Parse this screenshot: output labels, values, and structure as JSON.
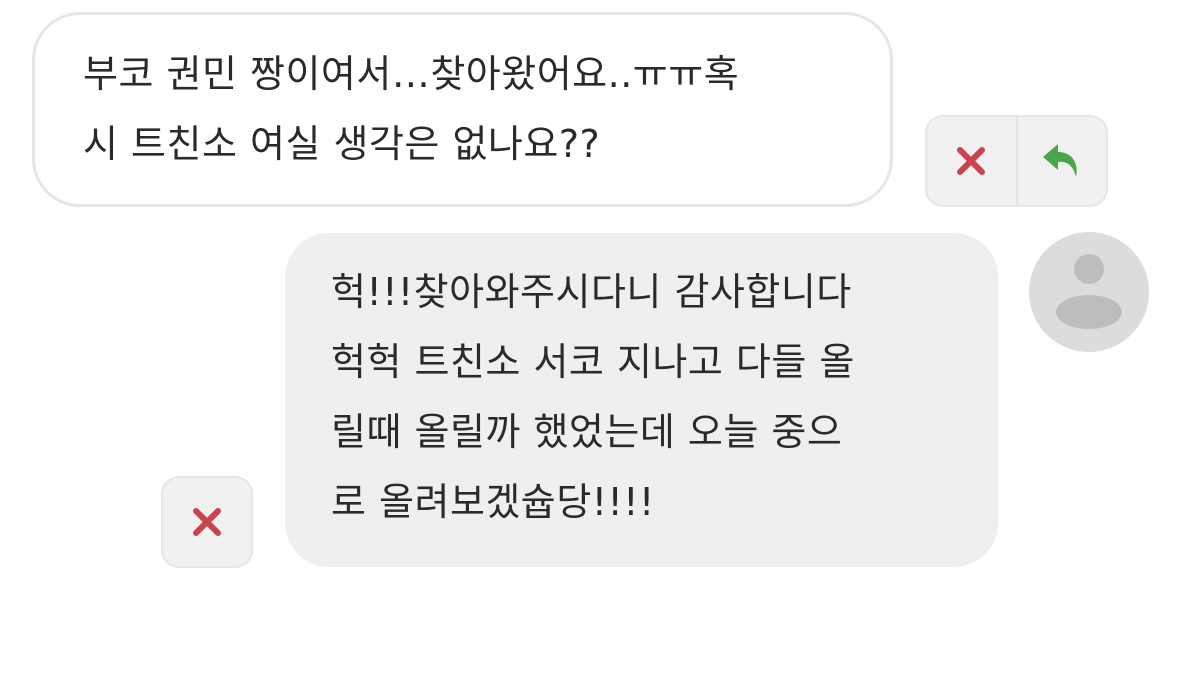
{
  "chat": {
    "messages": [
      {
        "direction": "incoming",
        "lines": [
          "부코 권민 짱이여서…찾아왔어요..ㅠㅠ혹",
          "시 트친소 여실 생각은 없나요??"
        ],
        "actions": [
          {
            "icon": "close-icon",
            "color": "#c9444f"
          },
          {
            "icon": "reply-icon",
            "color": "#4aa64a"
          }
        ]
      },
      {
        "direction": "outgoing",
        "lines": [
          "헉!!!찾아와주시다니 감사합니다",
          "헉헉 트친소 서코 지나고 다들 올",
          "릴때 올릴까 했었는데 오늘 중으",
          "로 올려보겠슙당!!!!"
        ],
        "actions": [
          {
            "icon": "close-icon",
            "color": "#c9444f"
          }
        ],
        "avatar": {
          "icon": "user-avatar-icon",
          "color": "#dcdcdc"
        }
      }
    ]
  }
}
